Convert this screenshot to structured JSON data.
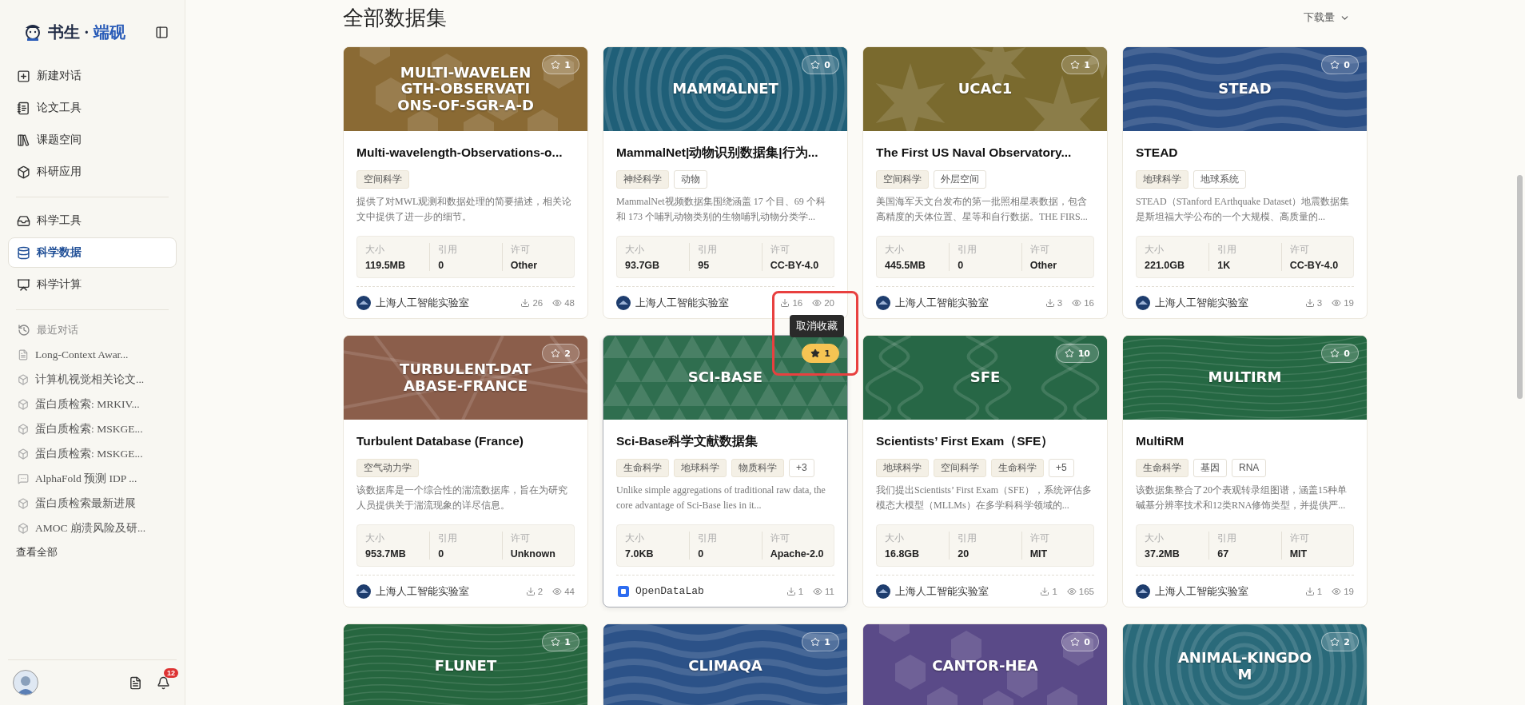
{
  "sidebar": {
    "brand": {
      "name": "书生",
      "separator": "·",
      "product": "端砚"
    },
    "nav_groups": [
      {
        "items": [
          {
            "label": "新建对话",
            "selected": false
          },
          {
            "label": "论文工具",
            "selected": false
          },
          {
            "label": "课题空间",
            "selected": false
          },
          {
            "label": "科研应用",
            "selected": false
          }
        ]
      },
      {
        "items": [
          {
            "label": "科学工具",
            "selected": false
          },
          {
            "label": "科学数据",
            "selected": true
          },
          {
            "label": "科学计算",
            "selected": false
          }
        ]
      }
    ],
    "recents": {
      "title": "最近对话",
      "items": [
        {
          "label": "Long-Context Awar...",
          "kind": "paper"
        },
        {
          "label": "计算机视觉相关论文...",
          "kind": "app"
        },
        {
          "label": "蛋白质检索: MRKIV...",
          "kind": "app"
        },
        {
          "label": "蛋白质检索: MSKGE...",
          "kind": "app"
        },
        {
          "label": "蛋白质检索: MSKGE...",
          "kind": "app"
        },
        {
          "label": "AlphaFold 预测 IDP ...",
          "kind": "chat"
        },
        {
          "label": "蛋白质检索最新进展",
          "kind": "app"
        },
        {
          "label": "AMOC 崩溃风险及研...",
          "kind": "app"
        }
      ],
      "view_all": "查看全部"
    },
    "notifications": {
      "count": "12"
    }
  },
  "main": {
    "title": "全部数据集",
    "sort": {
      "label": "下载量"
    },
    "cards": [
      {
        "banner": {
          "title": "MULTI-WAVELENGTH-OBSERVATIONS-OF-SGR-A-D",
          "kind": "hex",
          "color": "#8a6a34"
        },
        "star": {
          "count": "1",
          "starred": false
        },
        "hovered": false,
        "title": "Multi-wavelength-Observations-o...",
        "tags": [
          {
            "label": "空间科学",
            "kind": "domain"
          }
        ],
        "description": "提供了对MWL观测和数据处理的简要描述，相关论文中提供了进一步的细节。",
        "stats": [
          {
            "label": "大小",
            "value": "119.5MB"
          },
          {
            "label": "引用",
            "value": "0"
          },
          {
            "label": "许可",
            "value": "Other"
          }
        ],
        "org": {
          "name": "上海人工智能实验室",
          "kind": "lab"
        },
        "downloads": "26",
        "views": "48"
      },
      {
        "banner": {
          "title": "MAMMALNET",
          "kind": "rings",
          "color": "#1f5f78"
        },
        "star": {
          "count": "0",
          "starred": false
        },
        "hovered": false,
        "title": "MammalNet|动物识别数据集|行为...",
        "tags": [
          {
            "label": "神经科学",
            "kind": "domain"
          },
          {
            "label": "动物",
            "kind": "keyword"
          }
        ],
        "description": "MammalNet视频数据集围绕涵盖 17 个目、69 个科和 173 个哺乳动物类别的生物哺乳动物分类学...",
        "stats": [
          {
            "label": "大小",
            "value": "93.7GB"
          },
          {
            "label": "引用",
            "value": "95"
          },
          {
            "label": "许可",
            "value": "CC-BY-4.0"
          }
        ],
        "org": {
          "name": "上海人工智能实验室",
          "kind": "lab"
        },
        "downloads": "16",
        "views": "20"
      },
      {
        "banner": {
          "title": "UCAC1",
          "kind": "stars",
          "color": "#7a6a2e"
        },
        "star": {
          "count": "1",
          "starred": false
        },
        "hovered": false,
        "title": "The First US Naval Observatory...",
        "tags": [
          {
            "label": "空间科学",
            "kind": "domain"
          },
          {
            "label": "外层空间",
            "kind": "keyword"
          }
        ],
        "description": "美国海军天文台发布的第一批照相星表数据，包含高精度的天体位置、星等和自行数据。THE FIRS...",
        "stats": [
          {
            "label": "大小",
            "value": "445.5MB"
          },
          {
            "label": "引用",
            "value": "0"
          },
          {
            "label": "许可",
            "value": "Other"
          }
        ],
        "org": {
          "name": "上海人工智能实验室",
          "kind": "lab"
        },
        "downloads": "3",
        "views": "16"
      },
      {
        "banner": {
          "title": "STEAD",
          "kind": "waves",
          "color": "#2b4f86"
        },
        "star": {
          "count": "0",
          "starred": false
        },
        "hovered": false,
        "title": "STEAD",
        "tags": [
          {
            "label": "地球科学",
            "kind": "domain"
          },
          {
            "label": "地球系统",
            "kind": "keyword"
          }
        ],
        "description": "STEAD（STanford EArthquake Dataset）地震数据集是斯坦福大学公布的一个大规模、高质量的...",
        "stats": [
          {
            "label": "大小",
            "value": "221.0GB"
          },
          {
            "label": "引用",
            "value": "1K"
          },
          {
            "label": "许可",
            "value": "CC-BY-4.0"
          }
        ],
        "org": {
          "name": "上海人工智能实验室",
          "kind": "lab"
        },
        "downloads": "3",
        "views": "19"
      },
      {
        "banner": {
          "title": "TURBULENT-DATABASE-FRANCE",
          "kind": "lines",
          "color": "#8b5e4b"
        },
        "star": {
          "count": "2",
          "starred": false
        },
        "hovered": false,
        "title": "Turbulent Database (France)",
        "tags": [
          {
            "label": "空气动力学",
            "kind": "domain"
          }
        ],
        "description": "该数据库是一个综合性的湍流数据库，旨在为研究人员提供关于湍流现象的详尽信息。",
        "stats": [
          {
            "label": "大小",
            "value": "953.7MB"
          },
          {
            "label": "引用",
            "value": "0"
          },
          {
            "label": "许可",
            "value": "Unknown"
          }
        ],
        "org": {
          "name": "上海人工智能实验室",
          "kind": "lab"
        },
        "downloads": "2",
        "views": "44"
      },
      {
        "banner": {
          "title": "SCI-BASE",
          "kind": "triangles",
          "color": "#2f6e4f"
        },
        "star": {
          "count": "1",
          "starred": true,
          "tooltip": "取消收藏",
          "highlighted": true
        },
        "hovered": true,
        "title": "Sci-Base科学文献数据集",
        "tags": [
          {
            "label": "生命科学",
            "kind": "domain"
          },
          {
            "label": "地球科学",
            "kind": "domain"
          },
          {
            "label": "物质科学",
            "kind": "domain"
          },
          {
            "label": "+3",
            "kind": "more"
          }
        ],
        "description": "Unlike simple aggregations of traditional raw data, the core advantage of Sci-Base lies in it...",
        "stats": [
          {
            "label": "大小",
            "value": "7.0KB"
          },
          {
            "label": "引用",
            "value": "0"
          },
          {
            "label": "许可",
            "value": "Apache-2.0"
          }
        ],
        "org": {
          "name": "OpenDataLab",
          "kind": "odl"
        },
        "downloads": "1",
        "views": "11"
      },
      {
        "banner": {
          "title": "SFE",
          "kind": "helix",
          "color": "#276746"
        },
        "star": {
          "count": "10",
          "starred": false
        },
        "hovered": false,
        "title": "Scientists’ First Exam（SFE）",
        "tags": [
          {
            "label": "地球科学",
            "kind": "domain"
          },
          {
            "label": "空间科学",
            "kind": "domain"
          },
          {
            "label": "生命科学",
            "kind": "domain"
          },
          {
            "label": "+5",
            "kind": "more"
          }
        ],
        "description": "我们提出Scientists’ First Exam（SFE），系统评估多模态大模型（MLLMs）在多学科科学领域的...",
        "stats": [
          {
            "label": "大小",
            "value": "16.8GB"
          },
          {
            "label": "引用",
            "value": "20"
          },
          {
            "label": "许可",
            "value": "MIT"
          }
        ],
        "org": {
          "name": "上海人工智能实验室",
          "kind": "lab"
        },
        "downloads": "1",
        "views": "165"
      },
      {
        "banner": {
          "title": "MULTIRM",
          "kind": "flow",
          "color": "#256843"
        },
        "star": {
          "count": "0",
          "starred": false
        },
        "hovered": false,
        "title": "MultiRM",
        "tags": [
          {
            "label": "生命科学",
            "kind": "domain"
          },
          {
            "label": "基因",
            "kind": "keyword"
          },
          {
            "label": "RNA",
            "kind": "keyword"
          }
        ],
        "description": "该数据集整合了20个表观转录组图谱，涵盖15种单碱基分辨率技术和12类RNA修饰类型，并提供严...",
        "stats": [
          {
            "label": "大小",
            "value": "37.2MB"
          },
          {
            "label": "引用",
            "value": "67"
          },
          {
            "label": "许可",
            "value": "MIT"
          }
        ],
        "org": {
          "name": "上海人工智能实验室",
          "kind": "lab"
        },
        "downloads": "1",
        "views": "19"
      },
      {
        "banner": {
          "title": "FLUNET",
          "kind": "flow",
          "color": "#26663f"
        },
        "star": {
          "count": "1",
          "starred": false
        },
        "hovered": false
      },
      {
        "banner": {
          "title": "CLIMAQA",
          "kind": "waves",
          "color": "#2c5288"
        },
        "star": {
          "count": "1",
          "starred": false
        },
        "hovered": false
      },
      {
        "banner": {
          "title": "CANTOR-HEA",
          "kind": "hex",
          "color": "#5a4a88"
        },
        "star": {
          "count": "0",
          "starred": false
        },
        "hovered": false
      },
      {
        "banner": {
          "title": "ANIMAL-KINGDOM",
          "kind": "rings",
          "color": "#2a6a7a"
        },
        "star": {
          "count": "2",
          "starred": false
        },
        "hovered": false
      }
    ]
  }
}
